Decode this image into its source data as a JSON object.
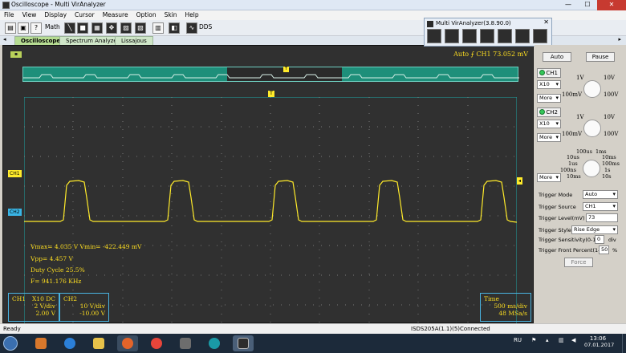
{
  "window": {
    "title": "Oscilloscope - Multi VirAnalyzer",
    "minimize": "—",
    "maximize": "☐",
    "close": "✕"
  },
  "menu": [
    "File",
    "View",
    "Display",
    "Cursor",
    "Measure",
    "Option",
    "Skin",
    "Help"
  ],
  "toolbar": {
    "math_label": "Math",
    "dds_label": "DDS"
  },
  "tabs": [
    "Oscilloscope",
    "Spectrum Analyzer",
    "Lissajous"
  ],
  "popup": {
    "title": "Multi VirAnalyzer(3.8.90.0)",
    "close": "✕"
  },
  "screen": {
    "trigger_info": "Auto  ⨍  CH1  73.052 mV",
    "trigger_mark": "T",
    "measurements": [
      "Vmax= 4.035 V   Vmin= -422.449 mV",
      "Vpp= 4.457 V",
      "Duty Cycle 25.5%",
      "F= 941.176 KHz"
    ],
    "ch1_marker": "CH1",
    "ch2_marker": "CH2",
    "ch1_box": {
      "name": "CH1",
      "probe": "X10  DC",
      "div": "2 V/div",
      "offset": "2.00 V"
    },
    "ch2_box": {
      "name": "CH2",
      "div": "10 V/div",
      "offset": "-10.00 V"
    },
    "time_box": {
      "label": "Time",
      "div": "500 ms/div",
      "rate": "48 MSa/s"
    }
  },
  "right_panel": {
    "auto_button": "Auto",
    "pause_button": "Pause",
    "ch1_button": "CH1",
    "ch2_button": "CH2",
    "probe_ch1": "X10",
    "probe_ch2": "X10",
    "more_label": "More",
    "volt_knob_labels": [
      "1V",
      "10V",
      "100mV",
      "100V"
    ],
    "time_knob_labels": [
      "100us",
      "1ms",
      "10us",
      "10ms",
      "1us",
      "100ms",
      "100ns",
      "1s",
      "10ms",
      "10s"
    ],
    "trigger_mode_label": "Trigger Mode",
    "trigger_mode_value": "Auto",
    "trigger_source_label": "Trigger Source",
    "trigger_source_value": "CH1",
    "trigger_level_label": "Trigger Level(mV)",
    "trigger_level_value": "73",
    "trigger_style_label": "Trigger Style",
    "trigger_style_value": "Rise Edge",
    "trigger_sens_label": "Trigger Sensitivity(0-1.0",
    "trigger_sens_value": "0",
    "trigger_sens_unit": "div",
    "trigger_front_label": "Trigger Front Percent(1-99",
    "trigger_front_value": "50",
    "trigger_front_unit": "%",
    "force_button": "Force"
  },
  "status": {
    "left": "Ready",
    "right": "ISDS205A(1.1)(5)Connected"
  },
  "taskbar": {
    "lang": "RU",
    "time": "13:06",
    "date": "07.01.2017"
  },
  "colors": {
    "trace": "#ffeb2a",
    "ch2": "#3ab6e6",
    "screen_bg": "#303030",
    "overview": "#1e8f7a"
  }
}
